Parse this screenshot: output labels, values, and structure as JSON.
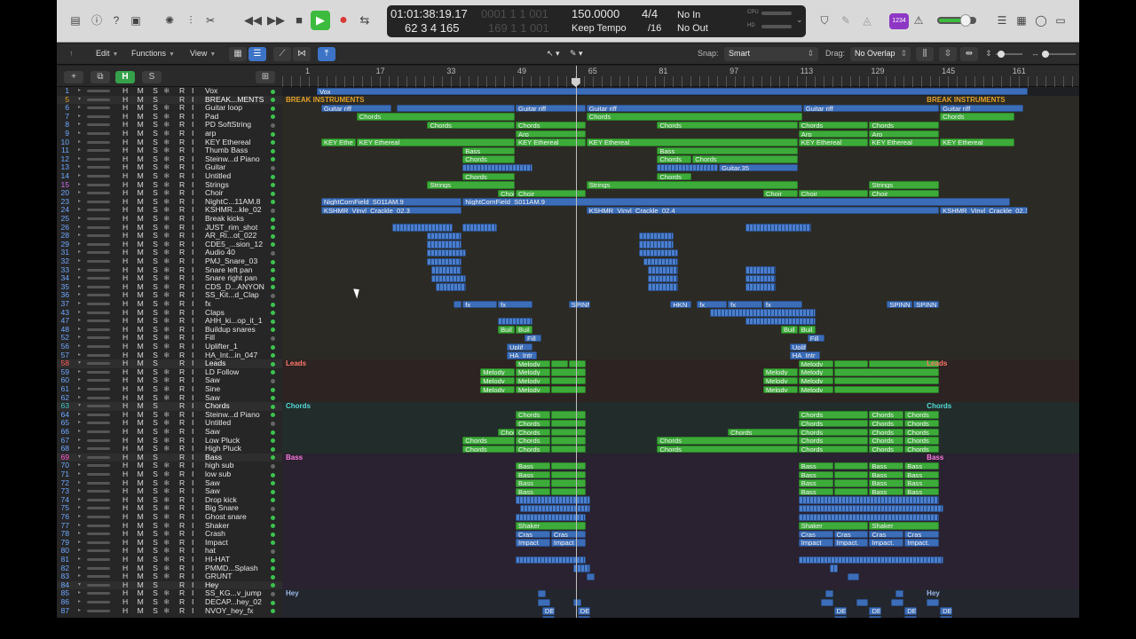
{
  "control_bar": {
    "icons": [
      "library-icon",
      "inspector-icon",
      "help-icon",
      "editor-icon",
      "tuner-icon",
      "mixer-icon",
      "scissors-icon"
    ],
    "transport": {
      "rewind": "rewind-icon",
      "forward": "forward-icon",
      "stop": "stop-icon",
      "play": "play-icon",
      "record": "record-icon"
    },
    "accent_play": "#3dbb3e",
    "accent_record": "#d83a34",
    "lcd": {
      "time": "01:01:38:19.17",
      "time_ghost": "0001 1 1 001",
      "bars": "62  3  4  165",
      "bars_ghost": "169  1  1  001",
      "tempo": "150.0000",
      "tempo_mode": "Keep Tempo",
      "signature": "4/4",
      "division": "/16",
      "midi_in": "No In",
      "midi_out": "No Out",
      "cpu_label": "CPU",
      "hd_label": "HD"
    },
    "count_badge": "1234"
  },
  "edit_bar": {
    "edit": "Edit",
    "functions": "Functions",
    "view": "View",
    "snap_label": "Snap:",
    "snap_value": "Smart",
    "drag_label": "Drag:",
    "drag_value": "No Overlap"
  },
  "track_header": {
    "add": "+",
    "h": "H",
    "s": "S"
  },
  "ruler": {
    "bars": [
      "1",
      "17",
      "33",
      "49",
      "65",
      "81",
      "97",
      "113",
      "129",
      "145",
      "161"
    ]
  },
  "tracks": [
    {
      "n": "1",
      "name": "Vox",
      "color": "#6ea7ff"
    },
    {
      "n": "5",
      "name": "BREAK...MENTS",
      "color": "#e3a12a",
      "folder": true
    },
    {
      "n": "6",
      "name": "Guitar loop"
    },
    {
      "n": "7",
      "name": "Pad"
    },
    {
      "n": "8",
      "name": "PD SoftString"
    },
    {
      "n": "9",
      "name": "arp"
    },
    {
      "n": "10",
      "name": "KEY Ethereal"
    },
    {
      "n": "11",
      "name": "Thumb Bass"
    },
    {
      "n": "12",
      "name": "Steinw...d Piano"
    },
    {
      "n": "13",
      "name": "Guitar"
    },
    {
      "n": "14",
      "name": "Untitled"
    },
    {
      "n": "15",
      "name": "Strings",
      "color": "#c86cf0"
    },
    {
      "n": "20",
      "name": "Choir"
    },
    {
      "n": "23",
      "name": "NightC...11AM.8"
    },
    {
      "n": "24",
      "name": "KSHMR...kle_02"
    },
    {
      "n": "25",
      "name": "Break kicks"
    },
    {
      "n": "26",
      "name": "JUST_rim_shot"
    },
    {
      "n": "28",
      "name": "AR_Ri...ot_022"
    },
    {
      "n": "29",
      "name": "CDE5_...sion_12"
    },
    {
      "n": "31",
      "name": "Audio 40"
    },
    {
      "n": "32",
      "name": "PMJ_Snare_03"
    },
    {
      "n": "33",
      "name": "Snare left pan"
    },
    {
      "n": "34",
      "name": "Snare right pan"
    },
    {
      "n": "35",
      "name": "CDS_D...ANYON"
    },
    {
      "n": "36",
      "name": "SS_Kit...d_Clap"
    },
    {
      "n": "37",
      "name": "fx"
    },
    {
      "n": "43",
      "name": "Claps"
    },
    {
      "n": "47",
      "name": "AHH_ki...op_it_1"
    },
    {
      "n": "48",
      "name": "Buildup snares"
    },
    {
      "n": "52",
      "name": "Fill"
    },
    {
      "n": "56",
      "name": "Uplifter_1"
    },
    {
      "n": "57",
      "name": "HA_Int...in_047"
    },
    {
      "n": "58",
      "name": "Leads",
      "color": "#ff5a5a",
      "folder": true
    },
    {
      "n": "59",
      "name": "LD Follow"
    },
    {
      "n": "60",
      "name": "Saw"
    },
    {
      "n": "61",
      "name": "Sine"
    },
    {
      "n": "62",
      "name": "Saw"
    },
    {
      "n": "63",
      "name": "Chords",
      "color": "#3fc4c4",
      "folder": true
    },
    {
      "n": "64",
      "name": "Steinw...d Piano"
    },
    {
      "n": "65",
      "name": "Untitled"
    },
    {
      "n": "66",
      "name": "Saw"
    },
    {
      "n": "67",
      "name": "Low Pluck"
    },
    {
      "n": "68",
      "name": "High Pluck"
    },
    {
      "n": "69",
      "name": "Bass",
      "color": "#ff5ad2",
      "folder": true
    },
    {
      "n": "70",
      "name": "high sub"
    },
    {
      "n": "71",
      "name": "low sub"
    },
    {
      "n": "72",
      "name": "Saw"
    },
    {
      "n": "73",
      "name": "Saw"
    },
    {
      "n": "74",
      "name": "Drop kick"
    },
    {
      "n": "75",
      "name": "Big Snare"
    },
    {
      "n": "76",
      "name": "Ghost snare"
    },
    {
      "n": "77",
      "name": "Shaker"
    },
    {
      "n": "78",
      "name": "Crash"
    },
    {
      "n": "79",
      "name": "Impact"
    },
    {
      "n": "80",
      "name": "hat"
    },
    {
      "n": "81",
      "name": "HI-HAT"
    },
    {
      "n": "82",
      "name": "PMMD...Splash"
    },
    {
      "n": "83",
      "name": "GRUNT"
    },
    {
      "n": "84",
      "name": "Hey",
      "folder": true
    },
    {
      "n": "85",
      "name": "SS_KG...v_jump"
    },
    {
      "n": "86",
      "name": "DECAP...hey_02"
    },
    {
      "n": "87",
      "name": "NVOY_hey_fx"
    }
  ],
  "summaries": {
    "break": "BREAK INSTRUMENTS",
    "leads": "Leads",
    "chords": "Chords",
    "bass": "Bass",
    "hey": "Hey"
  },
  "region_labels": {
    "vox": "Vox",
    "guitar_riff": "Guitar riff",
    "chords": "Chords",
    "arp": "Arp",
    "key": "KEY Ethereal",
    "key_short": "KEY Ethe",
    "bass": "Bass",
    "guitar35": "Guitar.35",
    "strings": "Strings",
    "choir": "Choir",
    "night": "NightCornField_S011AM.9",
    "kshmr3": "KSHMR_Vinyl_Crackle_02.3",
    "kshmr4": "KSHMR_Vinyl_Crackle_02.4",
    "kshmr1": "KSHMR_Vinyl_Crackle_02.1",
    "fx": "fx",
    "spinn": "SPINN",
    "hkn": "HKN",
    "buil": "Buil",
    "fill": "Fill",
    "uplif": "Uplif",
    "ha": "HA_Intr",
    "melody": "Melody",
    "shaker": "Shaker",
    "cras": "Cras",
    "impact": "Impact",
    "impact_short": "Impact.",
    "de": "DE",
    "nv": "NV"
  },
  "colors": {
    "region_green": "#3dab3a",
    "region_blue": "#3c6db8",
    "playhead": "#bfbfbf"
  }
}
